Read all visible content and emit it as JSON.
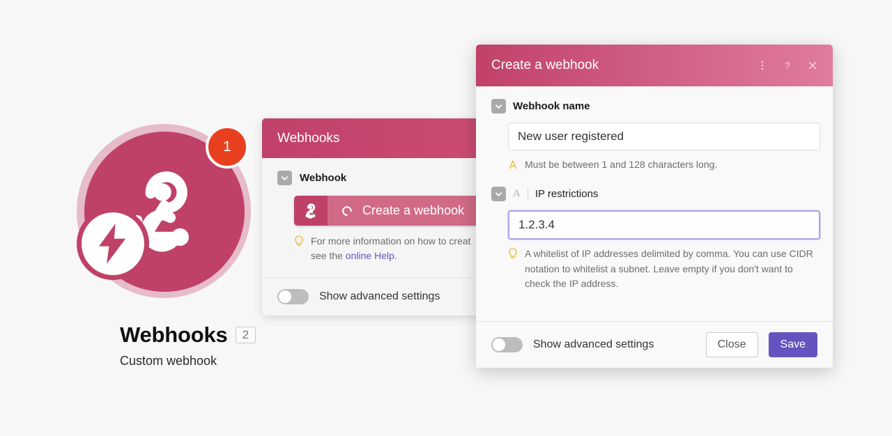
{
  "colors": {
    "background": "#f7f7f7",
    "brand_crimson": "#bf4168",
    "brand_pink": "#e07c9e",
    "accent_purple": "#6554c0",
    "badge_orange": "#e8401f",
    "focus_border": "#b0a6e6"
  },
  "logo": {
    "icon_name": "webhook-icon",
    "bolt_icon_name": "lightning-bolt-icon",
    "notification_count": "1",
    "title": "Webhooks",
    "count_badge": "2",
    "subtitle": "Custom webhook"
  },
  "back_panel": {
    "header_title": "Webhooks",
    "checkbox_icon": "chevron-down-icon",
    "section_label": "Webhook",
    "create_button": {
      "icon_name": "webhook-icon",
      "spinner_icon_name": "refresh-arc-icon",
      "label": "Create a webhook"
    },
    "hint": {
      "icon_name": "lightbulb-icon",
      "line1": "For more information on how to creat",
      "line2_prefix": "see the ",
      "link_text": "online Help",
      "line2_suffix": "."
    },
    "footer": {
      "toggle_name": "show-advanced-settings-toggle",
      "toggle_state": "off",
      "label": "Show advanced settings"
    }
  },
  "dialog": {
    "title": "Create a webhook",
    "header_icons": [
      {
        "name": "kebab-menu-icon",
        "glyph": "⋮"
      },
      {
        "name": "help-icon",
        "glyph": "?"
      },
      {
        "name": "close-icon",
        "glyph": "×"
      }
    ],
    "fields": [
      {
        "checkbox_icon": "chevron-down-icon",
        "label": "Webhook name",
        "label_bold": true,
        "value": "New user registered",
        "placeholder": "Webhook name",
        "focused": false,
        "note_icon": "warning-a-icon",
        "note": "Must be between 1 and 128 characters long."
      },
      {
        "checkbox_icon": "chevron-down-icon",
        "prefix_icon": "A",
        "label": "IP restrictions",
        "label_bold": false,
        "value": "1.2.3.4",
        "placeholder": "IP restrictions",
        "focused": true,
        "note_icon": "lightbulb-icon",
        "note": "A whitelist of IP addresses delimited by comma. You can use CIDR notation to whitelist a subnet. Leave empty if you don't want to check the IP address."
      }
    ],
    "footer": {
      "toggle_name": "show-advanced-settings-toggle",
      "toggle_state": "off",
      "toggle_label": "Show advanced settings",
      "close_label": "Close",
      "save_label": "Save"
    }
  }
}
